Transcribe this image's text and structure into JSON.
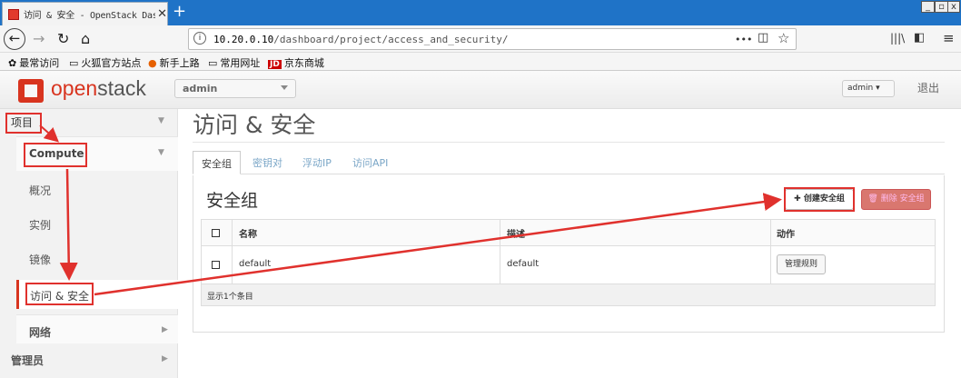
{
  "browser": {
    "tab_title": "访问 & 安全 - OpenStack Das",
    "tab_close": "✕",
    "new_tab": "+",
    "url_domain": "10.20.0.10",
    "url_path": "/dashboard/project/access_and_security/",
    "url_more": "•••",
    "bookmarks": [
      "最常访问",
      "火狐官方站点",
      "新手上路",
      "常用网址",
      "京东商城"
    ],
    "jd_badge": "JD"
  },
  "header": {
    "logo_open": "open",
    "logo_stack": "stack",
    "project": "admin",
    "user": "admin",
    "logout": "退出"
  },
  "sidebar": {
    "project": "项目",
    "compute": "Compute",
    "items": [
      "概况",
      "实例",
      "镜像",
      "访问 & 安全"
    ],
    "network": "网络",
    "admin": "管理员"
  },
  "main": {
    "page_title": "访问 & 安全",
    "tabs": [
      "安全组",
      "密钥对",
      "浮动IP",
      "访问API"
    ],
    "section_title": "安全组",
    "create_button": "创建安全组",
    "delete_button": "删除 安全组",
    "columns": [
      "名称",
      "描述",
      "动作"
    ],
    "rows": [
      {
        "name": "default",
        "description": "default",
        "action": "管理规则"
      }
    ],
    "footer": "显示1个条目"
  },
  "colors": {
    "accent_red": "#d8341f",
    "annotation_red": "#e0312d",
    "link_blue": "#7aa6c7"
  }
}
